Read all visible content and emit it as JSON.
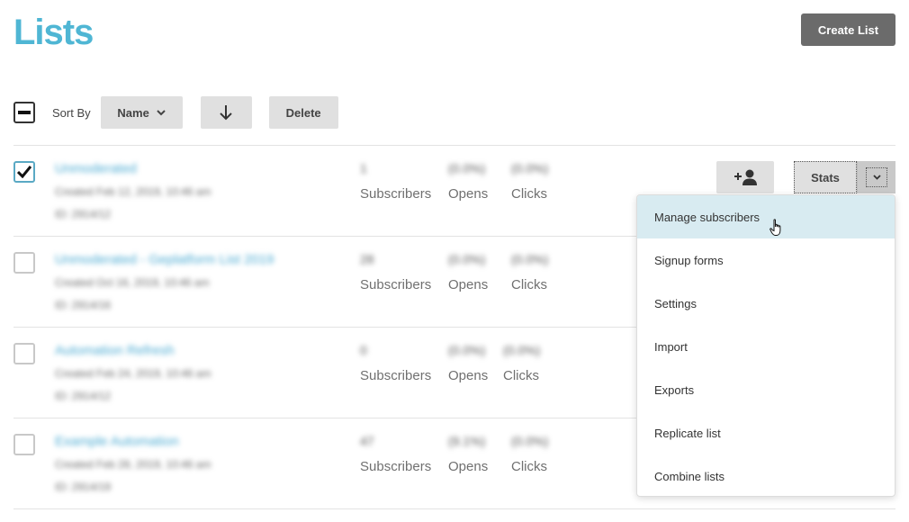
{
  "page": {
    "title": "Lists"
  },
  "header": {
    "create_label": "Create List"
  },
  "toolbar": {
    "sort_by_label": "Sort By",
    "sort_field": "Name",
    "delete_label": "Delete"
  },
  "rows": [
    {
      "checked": true,
      "name": "Unmoderated",
      "meta1": "Created Feb 12, 2019, 10:46 am",
      "meta2": "ID: 2914/12",
      "subscribers_value": "1",
      "opens_value": "(0.0%)",
      "clicks_value": "(0.0%)",
      "subscribers_label": "Subscribers",
      "opens_label": "Opens",
      "clicks_label": "Clicks"
    },
    {
      "checked": false,
      "name": "Unmoderated - Geplatform List 2019",
      "meta1": "Created Oct 16, 2019, 10:46 am",
      "meta2": "ID: 2914/16",
      "subscribers_value": "28",
      "opens_value": "(0.0%)",
      "clicks_value": "(0.0%)",
      "subscribers_label": "Subscribers",
      "opens_label": "Opens",
      "clicks_label": "Clicks"
    },
    {
      "checked": false,
      "name": "Automation Refresh",
      "meta1": "Created Feb 24, 2019, 10:46 am",
      "meta2": "ID: 2914/12",
      "subscribers_value": "0",
      "opens_value": "(0.0%)",
      "clicks_value": "(0.0%)",
      "subscribers_label": "Subscribers",
      "opens_label": "Opens",
      "clicks_label": "Clicks"
    },
    {
      "checked": false,
      "name": "Example Automation",
      "meta1": "Created Feb 28, 2019, 10:46 am",
      "meta2": "ID: 2914/19",
      "subscribers_value": "47",
      "opens_value": "(9.1%)",
      "clicks_value": "(0.0%)",
      "subscribers_label": "Subscribers",
      "opens_label": "Opens",
      "clicks_label": "Clicks"
    }
  ],
  "row_actions": {
    "stats_label": "Stats",
    "add_subscriber_icon": "add-user-icon"
  },
  "menu": {
    "items": [
      "Manage subscribers",
      "Signup forms",
      "Settings",
      "Import",
      "Exports",
      "Replicate list",
      "Combine lists"
    ]
  },
  "colors": {
    "title": "#4fb6d4",
    "link": "#4aaad2",
    "menu_active": "#d8ebf1",
    "primary_btn": "#6b6b6b"
  }
}
